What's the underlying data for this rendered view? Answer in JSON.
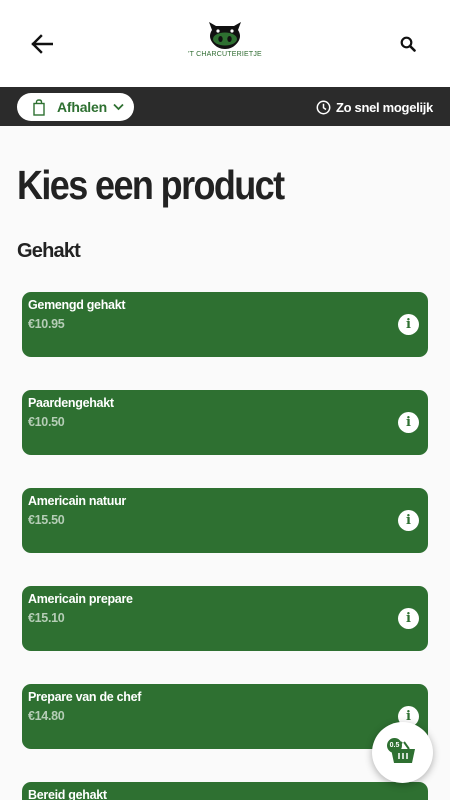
{
  "header": {
    "back_icon": "arrow-left-icon",
    "logo_text": "'T CHARCUTERIETJE",
    "search_icon": "search-icon"
  },
  "order_bar": {
    "mode_icon": "shopping-bag-icon",
    "mode_label": "Afhalen",
    "time_icon": "clock-icon",
    "time_label": "Zo snel mogelijk"
  },
  "page_title": "Kies een product",
  "section": {
    "title": "Gehakt",
    "products": [
      {
        "name": "Gemengd gehakt",
        "price": "€10.95"
      },
      {
        "name": "Paardengehakt",
        "price": "€10.50"
      },
      {
        "name": "Americain natuur",
        "price": "€15.50"
      },
      {
        "name": "Americain prepare",
        "price": "€15.10"
      },
      {
        "name": "Prepare van de chef",
        "price": "€14.80"
      },
      {
        "name": "Bereid gehakt",
        "price": ""
      }
    ]
  },
  "cart": {
    "count": "0.5",
    "icon": "basket-icon"
  },
  "colors": {
    "brand_green": "#2e7031",
    "bar_dark": "#2b2b2b",
    "price_muted": "#b5cdb6"
  }
}
